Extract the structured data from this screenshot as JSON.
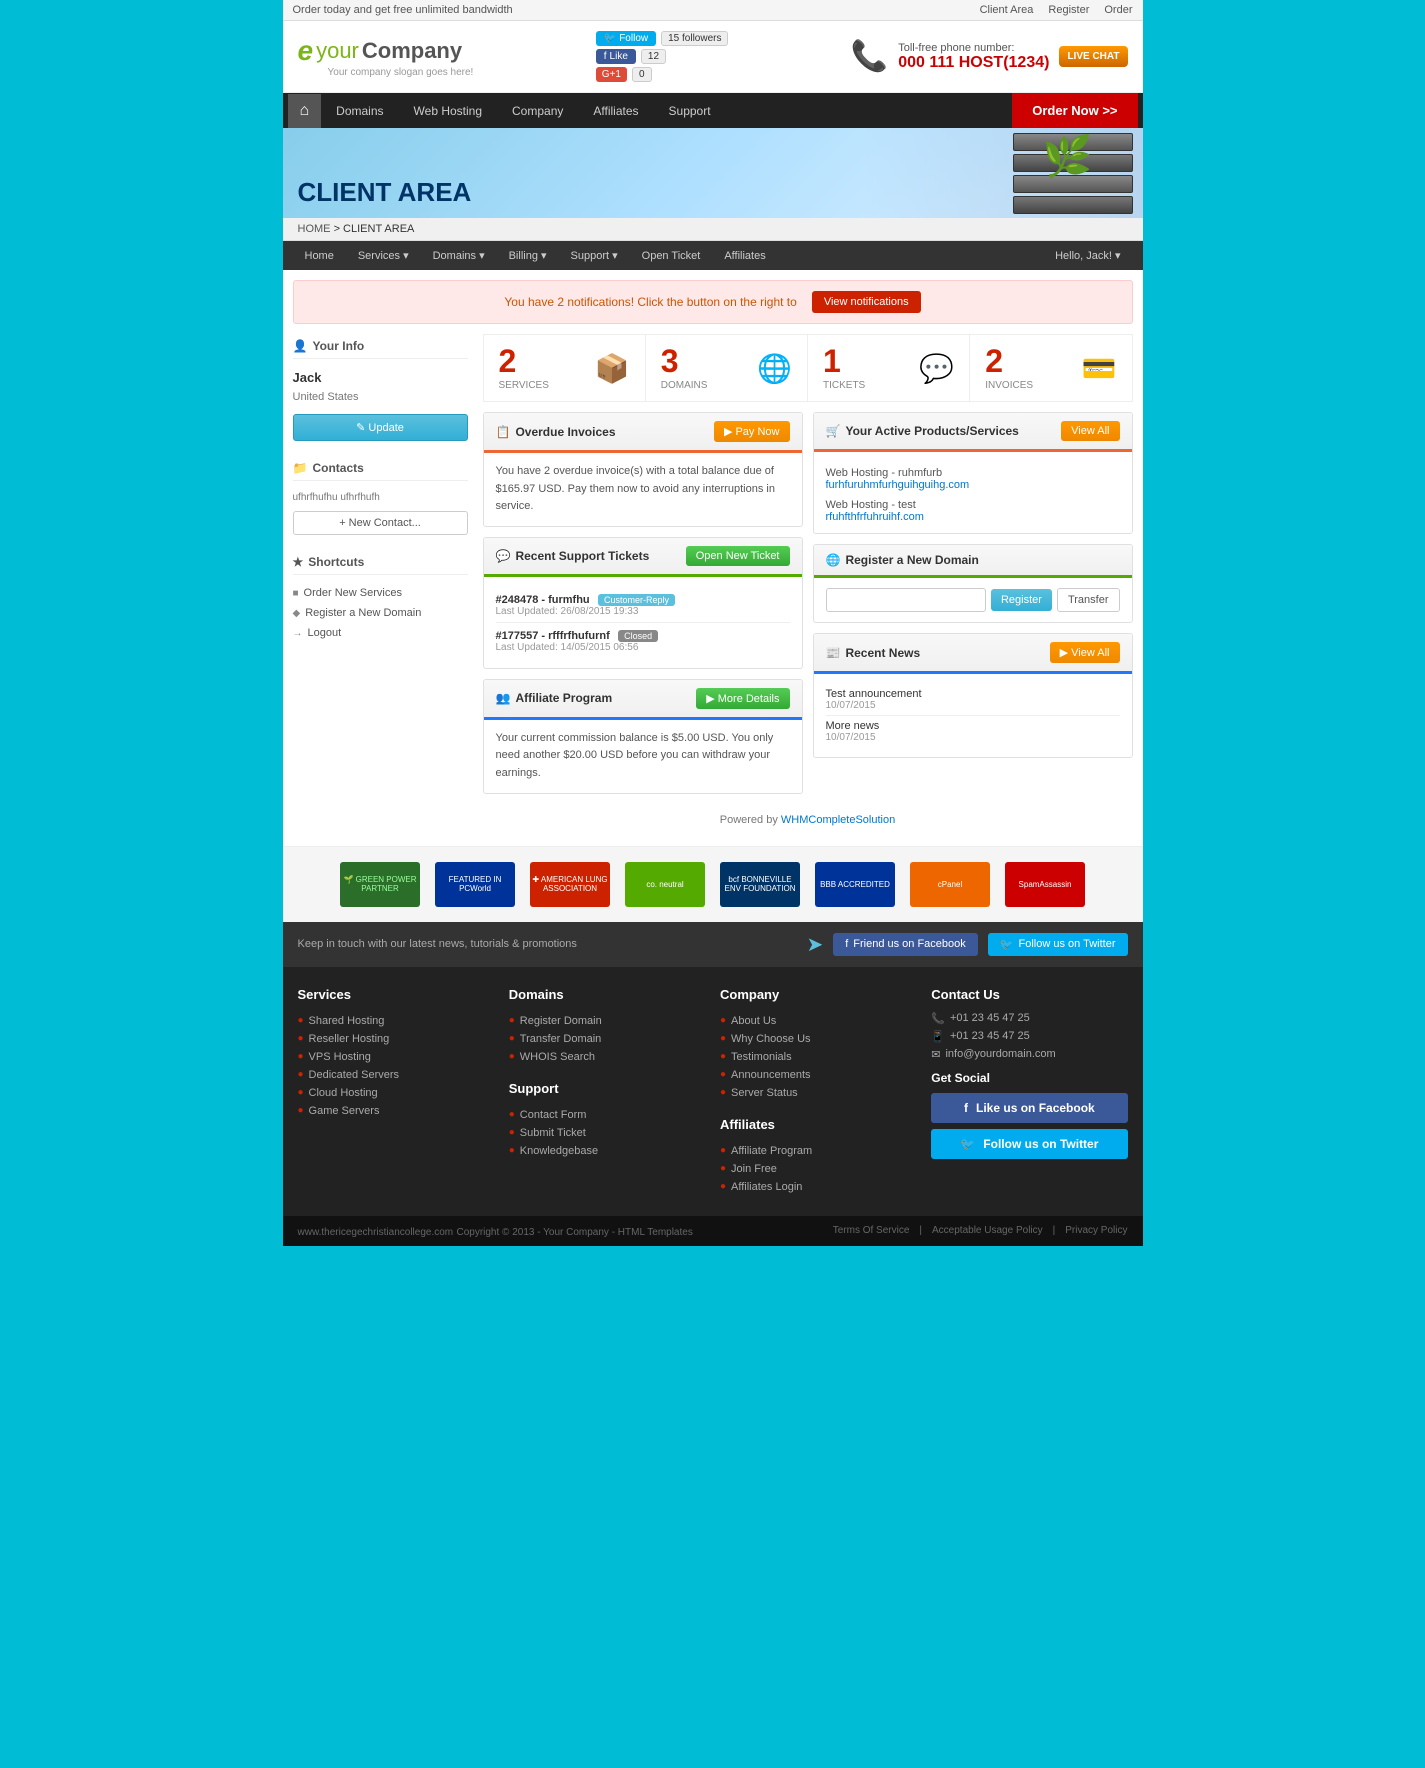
{
  "topbar": {
    "promo": "Order today and get free unlimited bandwidth",
    "links": [
      "Client Area",
      "Register",
      "Order"
    ]
  },
  "header": {
    "logo": {
      "e": "e",
      "your": "your",
      "company": "Company",
      "slogan": "Your company slogan goes here!"
    },
    "social": {
      "twitter_label": "Follow",
      "twitter_count": "15 followers",
      "fb_label": "Like",
      "fb_count": "12",
      "gplus_label": "G+1",
      "gplus_count": "0"
    },
    "phone": {
      "label": "Toll-free phone number:",
      "number": "000 111 HOST(1234)"
    },
    "live_chat": "LIVE CHAT"
  },
  "mainnav": {
    "home_icon": "⌂",
    "items": [
      "Domains",
      "Web Hosting",
      "Company",
      "Affiliates",
      "Support"
    ],
    "order_btn": "Order Now >>"
  },
  "hero": {
    "title": "CLIENT AREA"
  },
  "breadcrumb": {
    "home": "HOME",
    "current": "CLIENT AREA"
  },
  "secnav": {
    "items": [
      "Home",
      "Services",
      "Domains",
      "Billing",
      "Support",
      "Open Ticket",
      "Affiliates"
    ],
    "user": "Hello, Jack!"
  },
  "notification": {
    "text": "You have 2 notifications! Click the button on the right to",
    "btn": "View notifications"
  },
  "sidebar": {
    "your_info": "Your Info",
    "user_name": "Jack",
    "user_country": "United States",
    "update_btn": "✎ Update",
    "contacts_title": "Contacts",
    "contacts_email": "ufhrfhufhu ufhrfhufh",
    "new_contact_btn": "+ New Contact...",
    "shortcuts_title": "Shortcuts",
    "shortcuts": [
      {
        "icon": "■",
        "label": "Order New Services"
      },
      {
        "icon": "◆",
        "label": "Register a New Domain"
      },
      {
        "icon": "→",
        "label": "Logout"
      }
    ]
  },
  "stats": [
    {
      "number": "2",
      "label": "SERVICES",
      "icon": "📦"
    },
    {
      "number": "3",
      "label": "DOMAINS",
      "icon": "🌐"
    },
    {
      "number": "1",
      "label": "TICKETS",
      "icon": "💬"
    },
    {
      "number": "2",
      "label": "INVOICES",
      "icon": "💳"
    }
  ],
  "invoices": {
    "title": "Overdue Invoices",
    "btn": "▶ Pay Now",
    "text": "You have 2 overdue invoice(s) with a total balance due of $165.97 USD. Pay them now to avoid any interruptions in service."
  },
  "products": {
    "title": "Your Active Products/Services",
    "btn": "View All",
    "items": [
      {
        "label": "Web Hosting - ruhmfurb",
        "link": "furhfuruhmfurhguihguihg.com"
      },
      {
        "label": "Web Hosting - test",
        "link": "rfuhfthfrfuhruihf.com"
      }
    ]
  },
  "tickets": {
    "title": "Recent Support Tickets",
    "btn": "Open New Ticket",
    "items": [
      {
        "id": "#248478 - furmfhu",
        "badge": "Customer-Reply",
        "badge_class": "badge-customer",
        "date": "Last Updated: 26/08/2015 19:33"
      },
      {
        "id": "#177557 - rfffrfhufurnf",
        "badge": "Closed",
        "badge_class": "badge-closed",
        "date": "Last Updated: 14/05/2015 06:56"
      }
    ]
  },
  "register_domain": {
    "title": "Register a New Domain",
    "placeholder": "",
    "register_btn": "Register",
    "transfer_btn": "Transfer"
  },
  "news": {
    "title": "Recent News",
    "btn": "▶ View All",
    "items": [
      {
        "title": "Test announcement",
        "date": "10/07/2015"
      },
      {
        "title": "More news",
        "date": "10/07/2015"
      }
    ]
  },
  "affiliate": {
    "title": "Affiliate Program",
    "btn": "▶ More Details",
    "text": "Your current commission balance is $5.00 USD. You only need another $20.00 USD before you can withdraw your earnings."
  },
  "powered_by": {
    "text": "Powered by",
    "link": "WHMCompleteSolution"
  },
  "footer_top": {
    "text": "Keep in touch with our latest news, tutorials & promotions",
    "fb_label": "Friend us on Facebook",
    "tw_label": "Follow us on Twitter"
  },
  "footer_cols": {
    "services": {
      "title": "Services",
      "items": [
        "Shared Hosting",
        "Reseller Hosting",
        "VPS Hosting",
        "Dedicated Servers",
        "Cloud Hosting",
        "Game Servers"
      ]
    },
    "domains": {
      "title": "Domains",
      "items": [
        "Register Domain",
        "Transfer Domain",
        "WHOIS Search"
      ]
    },
    "support": {
      "title": "Support",
      "items": [
        "Contact Form",
        "Submit Ticket",
        "Knowledgebase"
      ]
    },
    "company": {
      "title": "Company",
      "items": [
        "About Us",
        "Why Choose Us",
        "Testimonials",
        "Announcements",
        "Server Status"
      ]
    },
    "affiliates": {
      "title": "Affiliates",
      "items": [
        "Affiliate Program",
        "Join Free",
        "Affiliates Login"
      ]
    },
    "contact": {
      "title": "Contact Us",
      "phone1": "+01 23 45 47 25",
      "phone2": "+01 23 45 47 25",
      "email": "info@yourdomain.com",
      "get_social": "Get Social",
      "fb_btn": "Like us on Facebook",
      "tw_btn": "Follow us on Twitter"
    }
  },
  "footer_bottom": {
    "copyright": "Copyright © 2013 - Your Company - HTML Templates",
    "links": [
      "Terms Of Service",
      "Acceptable Usage Policy",
      "Privacy Policy"
    ],
    "site": "www.thericegechristiancollege.com"
  }
}
